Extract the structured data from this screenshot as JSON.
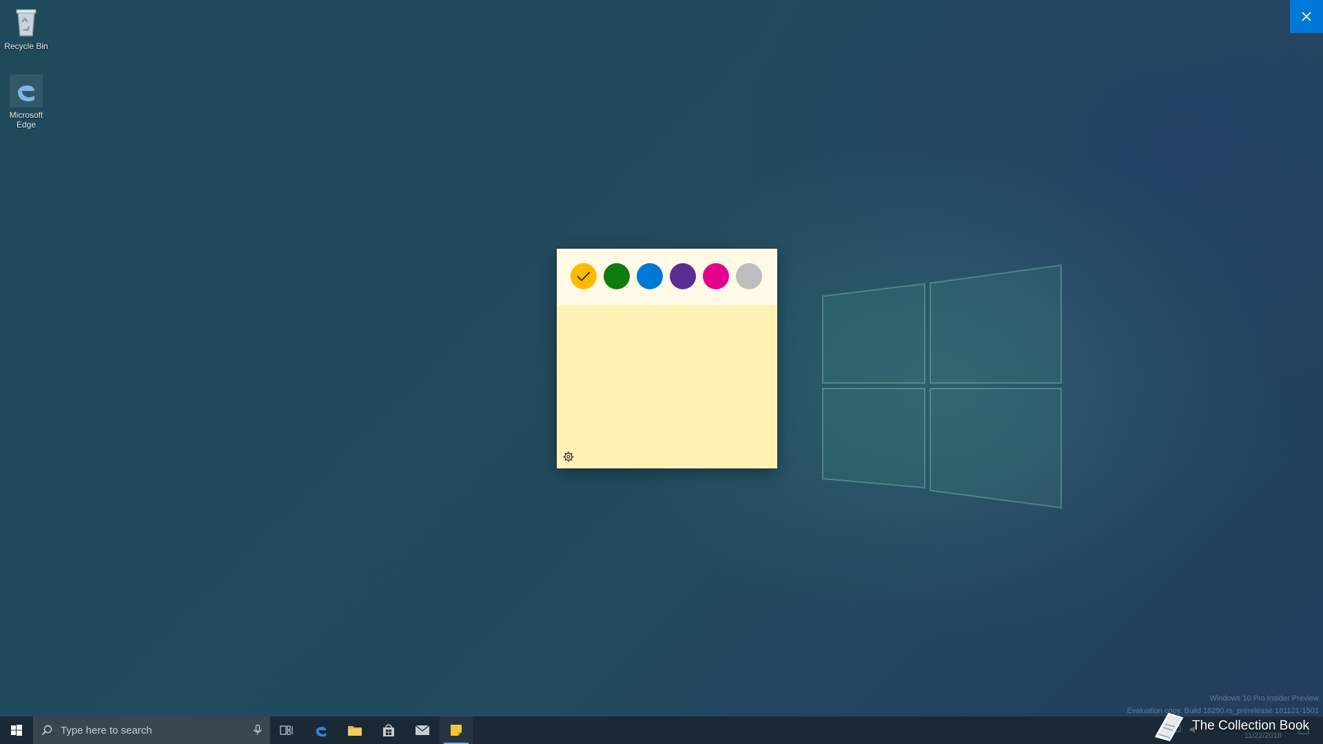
{
  "desktop": {
    "icons": [
      {
        "label": "Recycle Bin",
        "icon": "recycle-bin-icon"
      },
      {
        "label": "Microsoft Edge",
        "icon": "edge-icon"
      }
    ]
  },
  "close_button": {
    "icon": "close-icon",
    "color": "#0078d7"
  },
  "sticky_note": {
    "body_color": "#fff2b3",
    "header_color": "#fff9e6",
    "colors": [
      {
        "name": "Yellow",
        "hex": "#ffb900",
        "selected": true
      },
      {
        "name": "Green",
        "hex": "#107c10",
        "selected": false
      },
      {
        "name": "Blue",
        "hex": "#0078d7",
        "selected": false
      },
      {
        "name": "Purple",
        "hex": "#5c2d91",
        "selected": false
      },
      {
        "name": "Pink",
        "hex": "#e3008c",
        "selected": false
      },
      {
        "name": "Gray",
        "hex": "#bdbdbd",
        "selected": false
      }
    ],
    "settings_icon": "gear-icon"
  },
  "watermark": {
    "line1": "Windows 10 Pro Insider Preview",
    "line2": "Evaluation copy. Build 18290.rs_prerelease.181121-1501"
  },
  "taskbar": {
    "search_placeholder": "Type here to search",
    "apps": [
      "task-view-icon",
      "edge-icon",
      "file-explorer-icon",
      "store-icon",
      "mail-icon",
      "sticky-notes-icon"
    ],
    "active_app": "sticky-notes-icon",
    "tray_date": "11/22/2018"
  },
  "overlay": {
    "label": "The Collection Book"
  }
}
